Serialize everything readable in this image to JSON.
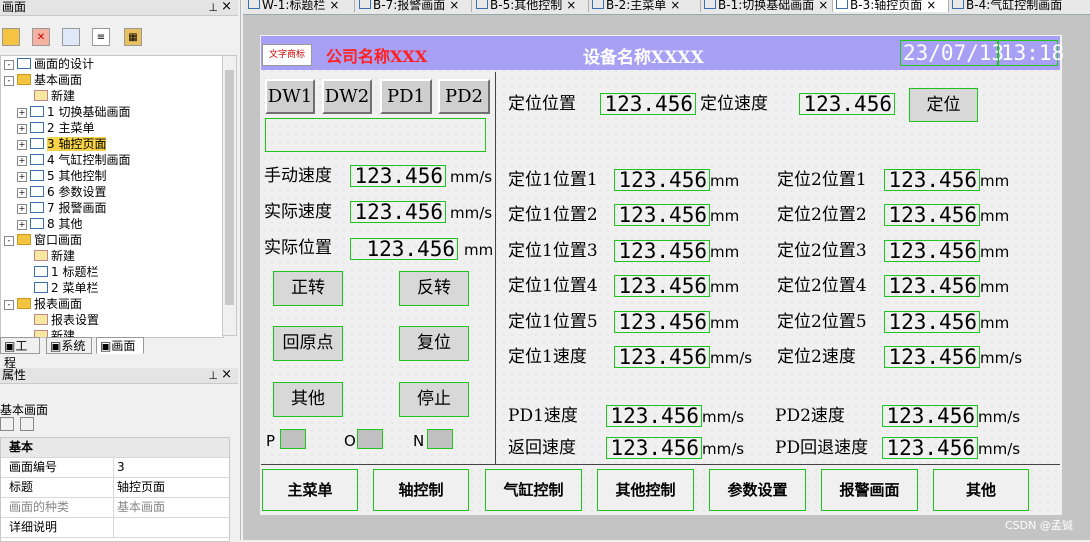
{
  "left_panel": {
    "screen_panel_title": "画面",
    "pin": "ᵖ",
    "close": "×",
    "tree": {
      "root": "画面的设计",
      "basic_folder": "基本画面",
      "new": "新建",
      "items": [
        "1 切换基础画面",
        "2 主菜单",
        "3 轴控页面",
        "4 气缸控制画面",
        "5 其他控制",
        "6 参数设置",
        "7 报警画面",
        "8 其他"
      ],
      "window_folder": "窗口画面",
      "window_new": "新建",
      "window_items": [
        "1 标题栏",
        "2 菜单栏"
      ],
      "report_folder": "报表画面",
      "report_items": [
        "报表设置",
        "新建"
      ]
    },
    "tabs": [
      "工程",
      "系统",
      "画面"
    ],
    "props_title": "属性",
    "props_subtitle": "基本画面",
    "props_group": "基本",
    "props": [
      {
        "k": "画面编号",
        "v": "3"
      },
      {
        "k": "标题",
        "v": "轴控页面"
      },
      {
        "k": "画面的种类",
        "v": "基本画面"
      },
      {
        "k": "详细说明",
        "v": ""
      }
    ]
  },
  "doc_tabs": [
    "W-1:标题栏",
    "B-7:报警画面",
    "B-5:其他控制",
    "B-2:主菜单",
    "B-1:切换基础画面",
    "B-3:轴控页面",
    "B-4:气缸控制画面"
  ],
  "hmi": {
    "logo": "文字商标",
    "company": "公司名称XXX",
    "device": "设备名称XXXX",
    "date": "23/07/13",
    "time": "13:18",
    "dw_buttons": [
      "DW1",
      "DW2",
      "PD1",
      "PD2"
    ],
    "manual_speed_label": "手动速度",
    "actual_speed_label": "实际速度",
    "actual_pos_label": "实际位置",
    "value": "123.456",
    "unit_mms": "mm/s",
    "unit_mm": "mm",
    "left_buttons": [
      "正转",
      "反转",
      "回原点",
      "复位",
      "其他",
      "停止"
    ],
    "leds": [
      "P",
      "O",
      "N"
    ],
    "pos_label": "定位位置",
    "speed_label": "定位速度",
    "pos_button": "定位",
    "col1_labels": [
      "定位1位置1",
      "定位1位置2",
      "定位1位置3",
      "定位1位置4",
      "定位1位置5",
      "定位1速度"
    ],
    "col2_labels": [
      "定位2位置1",
      "定位2位置2",
      "定位2位置3",
      "定位2位置4",
      "定位2位置5",
      "定位2速度"
    ],
    "pd1_speed": "PD1速度",
    "return_speed": "返回速度",
    "pd2_speed": "PD2速度",
    "pd_back_speed": "PD回退速度",
    "nav": [
      "主菜单",
      "轴控制",
      "气缸控制",
      "其他控制",
      "参数设置",
      "报警画面",
      "其他"
    ]
  },
  "watermark": "CSDN @孟铖"
}
